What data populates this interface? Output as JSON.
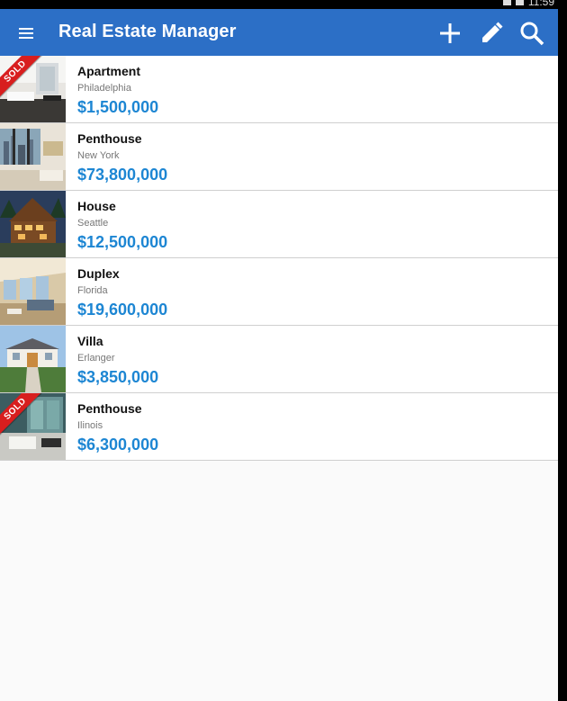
{
  "status_bar": {
    "time": "11:59"
  },
  "app_bar": {
    "title": "Real Estate Manager",
    "icons": [
      "menu-icon",
      "add-icon",
      "edit-icon",
      "search-icon"
    ],
    "color": "#2c6fc6"
  },
  "listings": [
    {
      "type": "Apartment",
      "location": "Philadelphia",
      "price": "$1,500,000",
      "sold": true,
      "sold_label": "SOLD",
      "thumb": "interior"
    },
    {
      "type": "Penthouse",
      "location": "New York",
      "price": "$73,800,000",
      "sold": false,
      "sold_label": "",
      "thumb": "cityview"
    },
    {
      "type": "House",
      "location": "Seattle",
      "price": "$12,500,000",
      "sold": false,
      "sold_label": "",
      "thumb": "lodge"
    },
    {
      "type": "Duplex",
      "location": "Florida",
      "price": "$19,600,000",
      "sold": false,
      "sold_label": "",
      "thumb": "livingroom"
    },
    {
      "type": "Villa",
      "location": "Erlanger",
      "price": "$3,850,000",
      "sold": false,
      "sold_label": "",
      "thumb": "villa"
    },
    {
      "type": "Penthouse",
      "location": "Ilinois",
      "price": "$6,300,000",
      "sold": true,
      "sold_label": "SOLD",
      "thumb": "glass"
    }
  ],
  "colors": {
    "price": "#1d86d3",
    "sold_ribbon": "#d81e1e",
    "background": "#fafafa"
  }
}
